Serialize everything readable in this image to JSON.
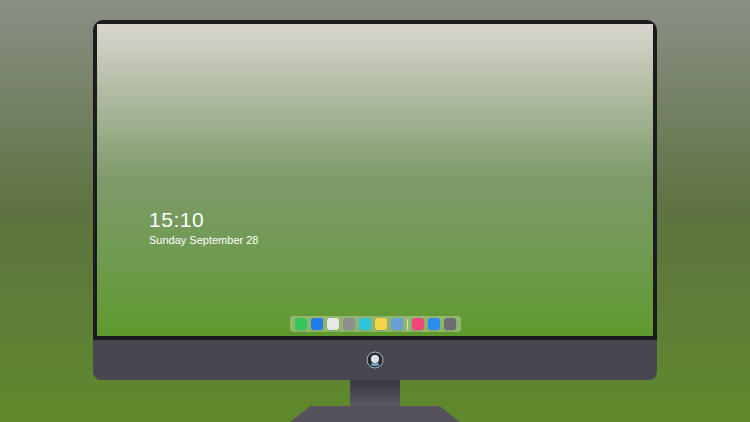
{
  "lock_screen": {
    "time": "15:10",
    "date": "Sunday September 28"
  },
  "dock": {
    "items": [
      {
        "kind": "app",
        "color": "#34c759"
      },
      {
        "kind": "app",
        "color": "#1e7be8"
      },
      {
        "kind": "app",
        "color": "#e8e8e8"
      },
      {
        "kind": "app",
        "color": "#8e8e93"
      },
      {
        "kind": "app",
        "color": "#2ec4e0"
      },
      {
        "kind": "app",
        "color": "#f5d547"
      },
      {
        "kind": "app",
        "color": "#6a9fd8"
      },
      {
        "kind": "separator",
        "color": "#ffffff"
      },
      {
        "kind": "app",
        "color": "#f5447a"
      },
      {
        "kind": "app",
        "color": "#2d8cf0"
      },
      {
        "kind": "app",
        "color": "#6b6b70"
      }
    ]
  }
}
